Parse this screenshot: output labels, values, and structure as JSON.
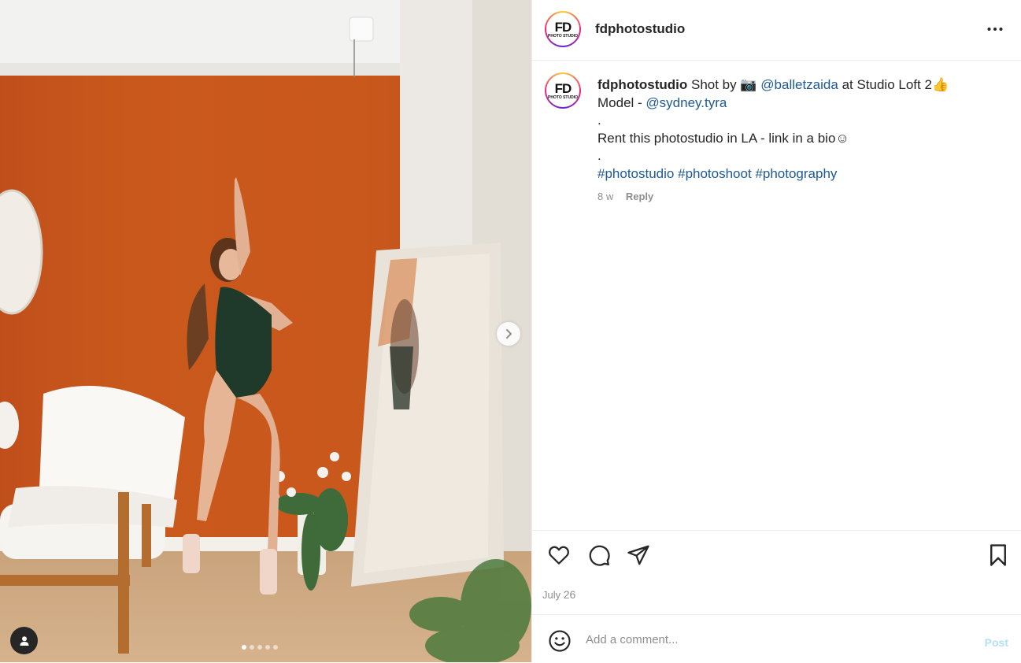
{
  "post": {
    "username": "fdphotostudio",
    "avatar_text_big": "FD",
    "avatar_text_small": "PHOTO STUDIO",
    "caption": {
      "username": "fdphotostudio",
      "part1": "Shot by",
      "camera_emoji": "📷",
      "mention_photographer": "@balletzaida",
      "part2": "at Studio Loft 2",
      "thumbs_emoji": "👍",
      "model_label": "Model - ",
      "mention_model": "@sydney.tyra",
      "dot1": ".",
      "line_rent": "Rent this photostudio in LA - link in a bio",
      "smile_emoji": "☺",
      "dot2": ".",
      "hashtag1": "#photostudio",
      "hashtag2": "#photoshoot",
      "hashtag3": "#photography"
    },
    "time_ago": "8 w",
    "reply_label": "Reply",
    "date_month": "July",
    "date_day": "26"
  },
  "comment_box": {
    "placeholder": "Add a comment...",
    "post_label": "Post"
  },
  "carousel": {
    "total_slides": 5,
    "active_index": 0
  },
  "icons": {
    "more": "more-horizontal-icon",
    "like": "heart-icon",
    "comment": "comment-bubble-icon",
    "share": "paper-plane-icon",
    "save": "bookmark-icon",
    "emoji": "emoji-smile-icon",
    "next": "chevron-right-icon",
    "tagged": "user-tag-icon"
  },
  "colors": {
    "link": "#1e5a92",
    "post_button_disabled": "#b2dffc",
    "muted": "#8e8e8e"
  }
}
